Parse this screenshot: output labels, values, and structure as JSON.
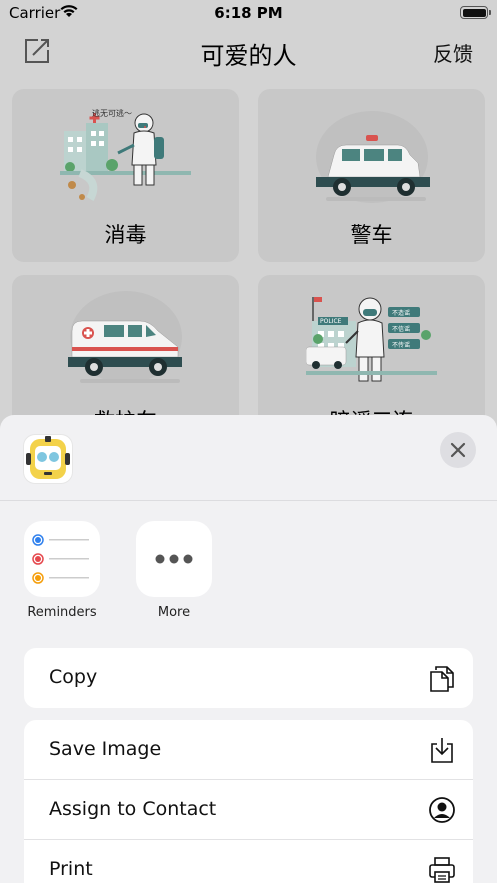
{
  "status_bar": {
    "carrier": "Carrier",
    "time": "6:18 PM"
  },
  "nav": {
    "title": "可爱的人",
    "feedback_label": "反馈",
    "left_icon": "edit-icon"
  },
  "cards": [
    {
      "label": "消毒",
      "icon": "disinfect-illustration",
      "caption": "逃无可逃～"
    },
    {
      "label": "警车",
      "icon": "police-car-illustration"
    },
    {
      "label": "救护车",
      "icon": "ambulance-illustration"
    },
    {
      "label": "暗谣三连",
      "icon": "rumor-officer-illustration",
      "signs": [
        "不造谣",
        "不信谣",
        "不传谣"
      ],
      "police_sign": "POLICE"
    }
  ],
  "share_sheet": {
    "close_icon": "close-icon",
    "apps": [
      {
        "label": "Reminders",
        "icon": "reminders-icon"
      },
      {
        "label": "More",
        "icon": "more-icon"
      }
    ],
    "actions_group1": [
      {
        "label": "Copy",
        "icon": "copy-icon"
      }
    ],
    "actions_group2": [
      {
        "label": "Save Image",
        "icon": "save-image-icon"
      },
      {
        "label": "Assign to Contact",
        "icon": "contact-icon"
      },
      {
        "label": "Print",
        "icon": "print-icon"
      }
    ]
  },
  "colors": {
    "teal": "#3f7a7a",
    "red": "#d9534f",
    "sheet_bg": "#f1f1f3",
    "card_bg": "#c8c8c8"
  }
}
